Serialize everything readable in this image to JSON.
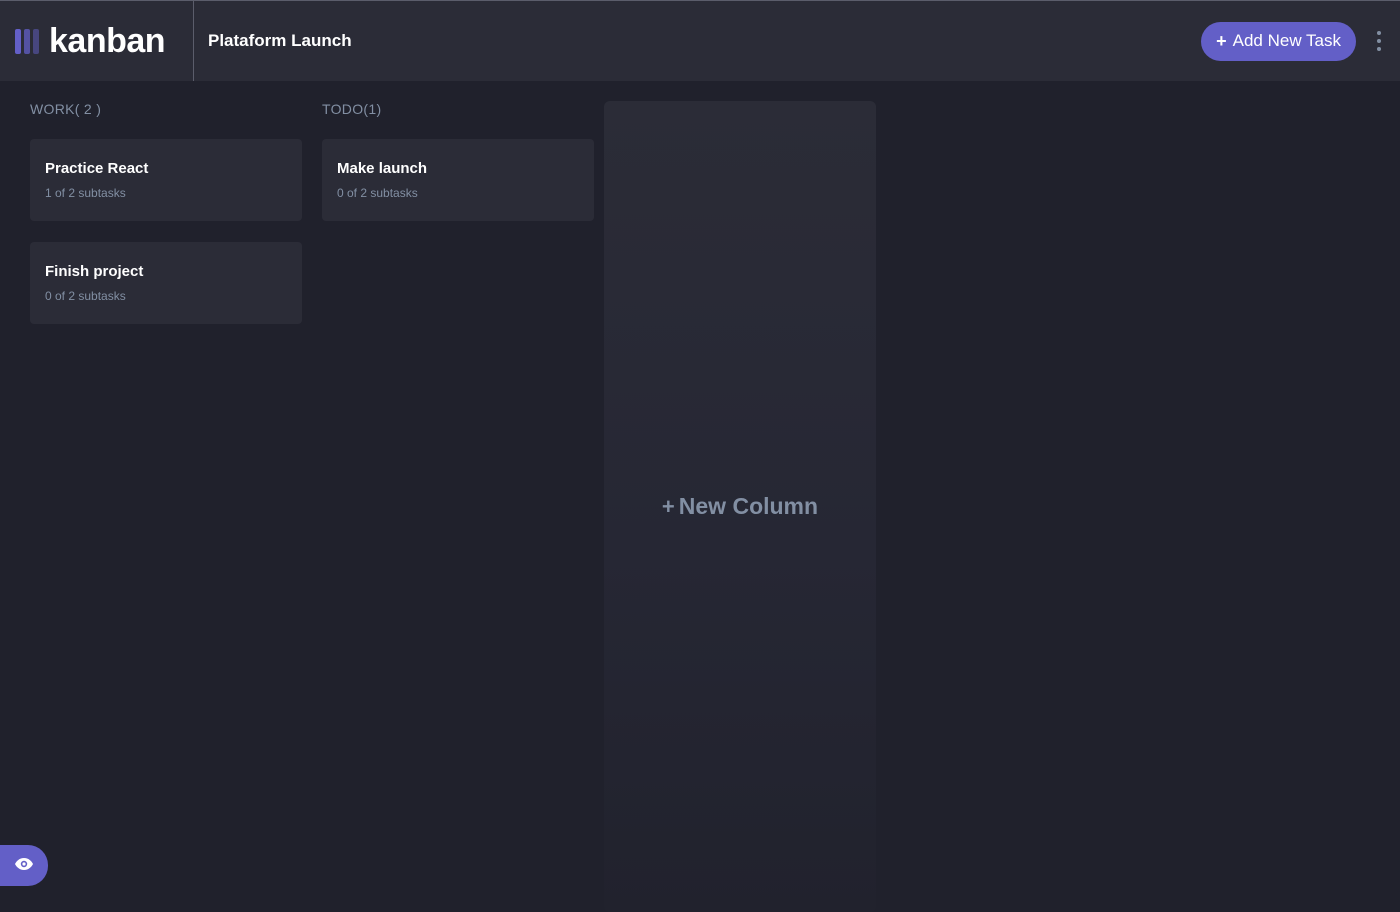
{
  "app": {
    "logo_text": "kanban"
  },
  "header": {
    "board_title": "Plataform Launch",
    "add_task_label": "Add New Task",
    "add_task_plus": "+"
  },
  "columns": [
    {
      "name": "WORK",
      "count": "( 2 )",
      "tasks": [
        {
          "title": "Practice React",
          "subtasks": "1 of 2 subtasks"
        },
        {
          "title": "Finish project",
          "subtasks": "0 of 2 subtasks"
        }
      ]
    },
    {
      "name": "TODO",
      "count": "(1)",
      "tasks": [
        {
          "title": "Make launch",
          "subtasks": "0 of 2 subtasks"
        }
      ]
    }
  ],
  "new_column": {
    "plus": "+",
    "label": "New Column"
  },
  "icons": {
    "logo": "kanban-logo-icon",
    "menu": "vertical-ellipsis-icon",
    "show_sidebar": "eye-icon"
  },
  "colors": {
    "accent": "#635fc7",
    "background": "#20212c",
    "surface": "#2b2c37",
    "muted_text": "#828fa3",
    "text": "#ffffff"
  }
}
